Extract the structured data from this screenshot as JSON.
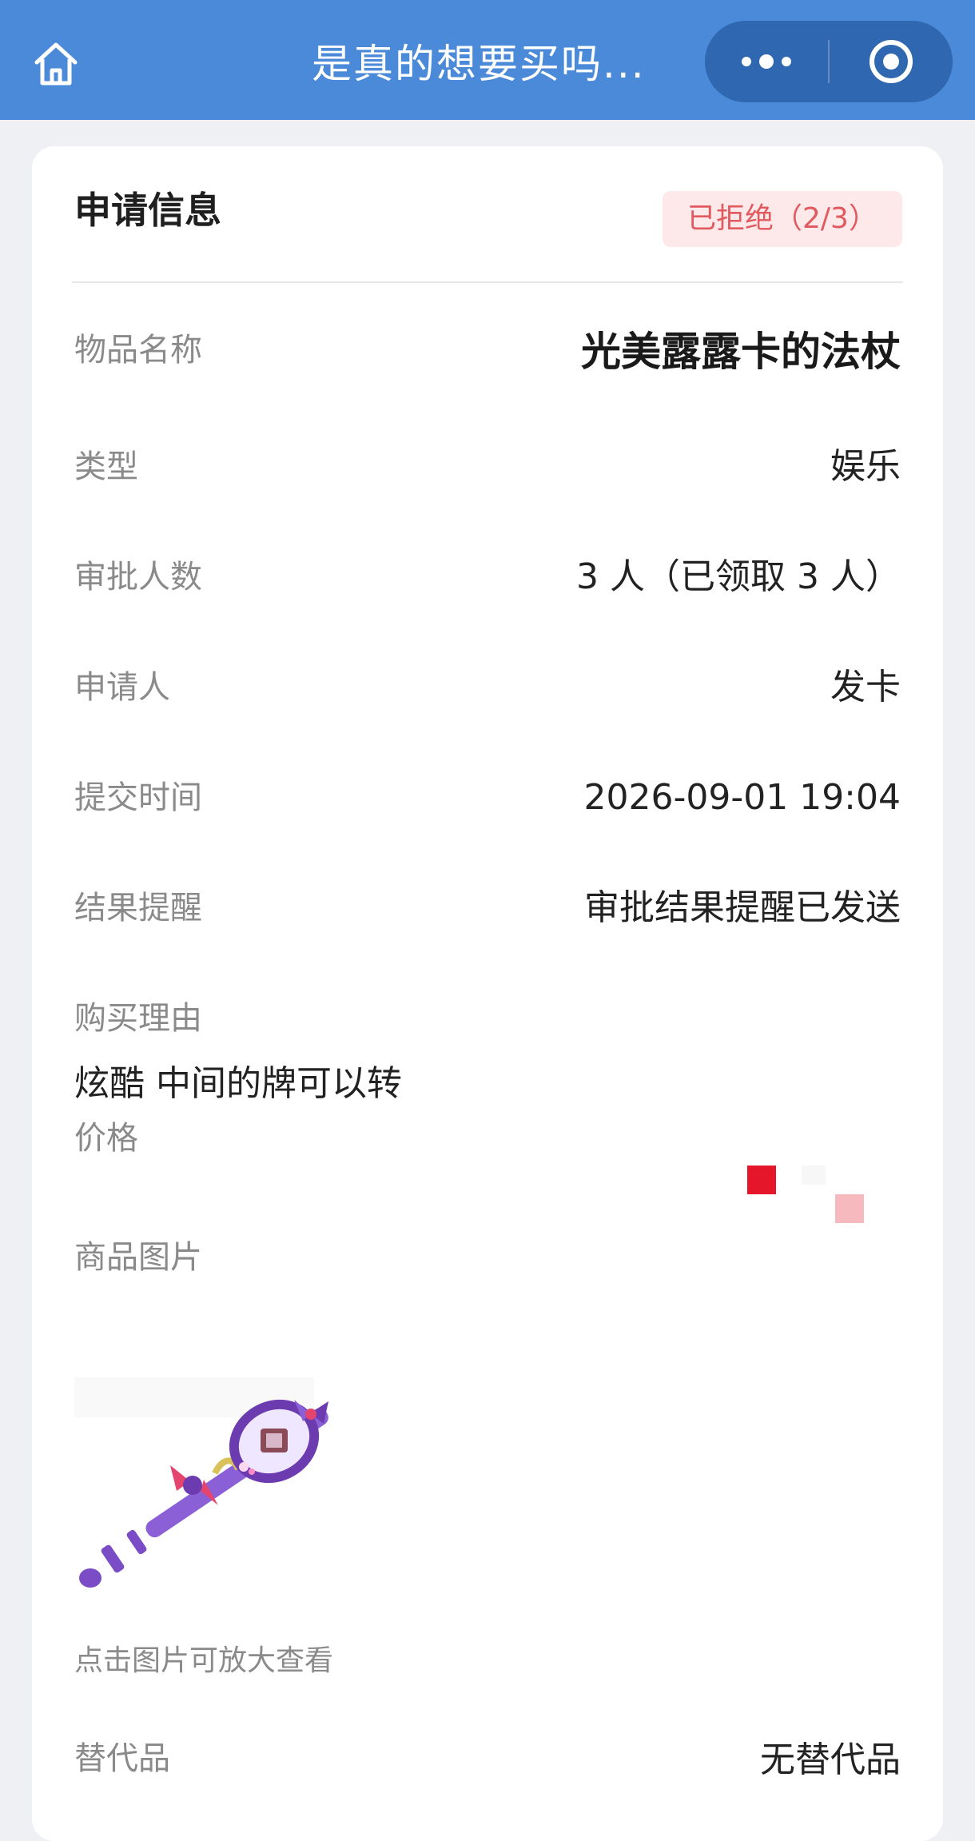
{
  "nav": {
    "title": "是真的想要买吗...",
    "home_icon": "home-icon",
    "more_icon": "more-dots-icon",
    "close_icon": "circle-target-icon"
  },
  "card": {
    "title": "申请信息",
    "status": "已拒绝（2/3）",
    "status_color": "#e05a5f",
    "fields": {
      "item_name": {
        "label": "物品名称",
        "value": "光美露露卡的法杖"
      },
      "type": {
        "label": "类型",
        "value": "娱乐"
      },
      "approvers": {
        "label": "审批人数",
        "value": "3 人（已领取 3 人）"
      },
      "applicant": {
        "label": "申请人",
        "value": "发卡"
      },
      "submit_time": {
        "label": "提交时间",
        "value": "2026-09-01 19:04"
      },
      "result_reminder": {
        "label": "结果提醒",
        "value": "审批结果提醒已发送"
      },
      "reason": {
        "label": "购买理由",
        "value": "炫酷 中间的牌可以转"
      },
      "price": {
        "label": "价格"
      },
      "image": {
        "label": "商品图片",
        "hint": "点击图片可放大查看"
      },
      "substitute": {
        "label": "替代品",
        "value": "无替代品"
      }
    }
  },
  "colors": {
    "header": "#4a8ad8",
    "capsule": "#2f67b0",
    "wand_purple": "#8b5fd6",
    "wand_bow": "#e3456e",
    "price_redaction": "#e5152a"
  }
}
